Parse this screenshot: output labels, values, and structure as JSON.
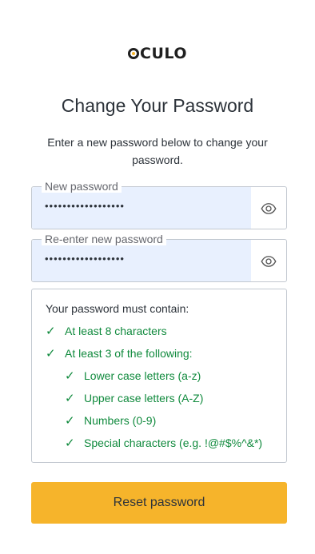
{
  "brand": {
    "logo_text": "CULO"
  },
  "header": {
    "title": "Change Your Password",
    "subtitle": "Enter a new password below to change your password."
  },
  "form": {
    "new_password": {
      "label": "New password",
      "value": "••••••••••••••••••",
      "toggle_icon": "eye-icon"
    },
    "reenter_password": {
      "label": "Re-enter new password",
      "value": "••••••••••••••••••",
      "toggle_icon": "eye-icon"
    }
  },
  "requirements": {
    "heading": "Your password must contain:",
    "check_glyph": "✓",
    "items": [
      {
        "text": "At least 8 characters"
      },
      {
        "text": "At least 3 of the following:"
      },
      {
        "text": "Lower case letters (a-z)"
      },
      {
        "text": "Upper case letters (A-Z)"
      },
      {
        "text": "Numbers (0-9)"
      },
      {
        "text": "Special characters (e.g. !@#$%^&*)"
      }
    ]
  },
  "actions": {
    "reset_label": "Reset password"
  },
  "colors": {
    "accent": "#f6b42b",
    "success": "#108a3d",
    "autofill": "#e8f0fe",
    "border": "#c2c8d0"
  }
}
